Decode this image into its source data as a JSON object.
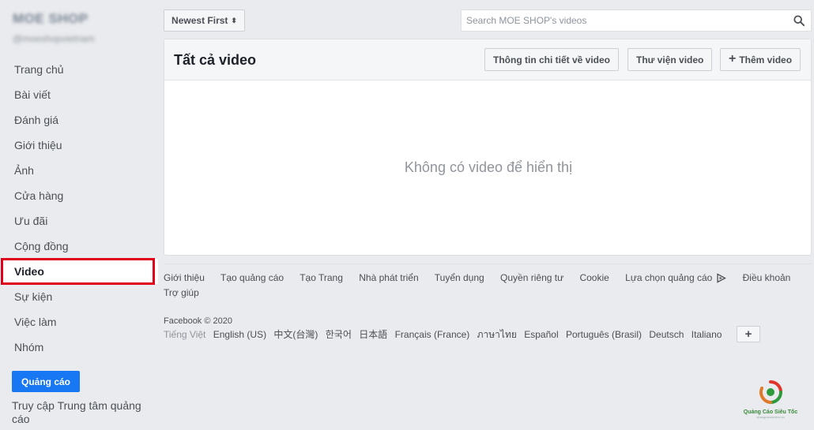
{
  "sidebar": {
    "page_name": "MOE SHOP",
    "page_handle": "@moeshopvietnam",
    "items": [
      {
        "label": "Trang chủ",
        "active": false
      },
      {
        "label": "Bài viết",
        "active": false
      },
      {
        "label": "Đánh giá",
        "active": false
      },
      {
        "label": "Giới thiệu",
        "active": false
      },
      {
        "label": "Ảnh",
        "active": false
      },
      {
        "label": "Cửa hàng",
        "active": false
      },
      {
        "label": "Ưu đãi",
        "active": false
      },
      {
        "label": "Cộng đồng",
        "active": false
      },
      {
        "label": "Video",
        "active": true
      },
      {
        "label": "Sự kiện",
        "active": false
      },
      {
        "label": "Việc làm",
        "active": false
      },
      {
        "label": "Nhóm",
        "active": false
      }
    ],
    "ads_button": "Quảng cáo",
    "ads_center_link": "Truy cập Trung tâm quảng cáo"
  },
  "toolbar": {
    "sort_label": "Newest First",
    "search_placeholder": "Search MOE SHOP's videos",
    "search_value": ""
  },
  "main": {
    "title": "Tất cả video",
    "buttons": {
      "insights": "Thông tin chi tiết về video",
      "library": "Thư viện video",
      "add": "Thêm video"
    },
    "empty_message": "Không có video để hiển thị"
  },
  "footer": {
    "links": [
      "Giới thiệu",
      "Tạo quảng cáo",
      "Tạo Trang",
      "Nhà phát triển",
      "Tuyển dụng",
      "Quyền riêng tư",
      "Cookie",
      "Lựa chọn quảng cáo",
      "Điều khoản",
      "Trợ giúp"
    ],
    "copyright": "Facebook © 2020",
    "languages": [
      "Tiếng Việt",
      "English (US)",
      "中文(台灣)",
      "한국어",
      "日本語",
      "Français (France)",
      "ภาษาไทย",
      "Español",
      "Português (Brasil)",
      "Deutsch",
      "Italiano"
    ],
    "current_language": "Tiếng Việt"
  },
  "watermark": {
    "text": "Quảng Cáo Siêu Tốc",
    "subtext": "quangcaosieutoc.vn"
  },
  "colors": {
    "primary": "#1877f2",
    "highlight_border": "#e0001b",
    "background": "#e9ebee"
  }
}
